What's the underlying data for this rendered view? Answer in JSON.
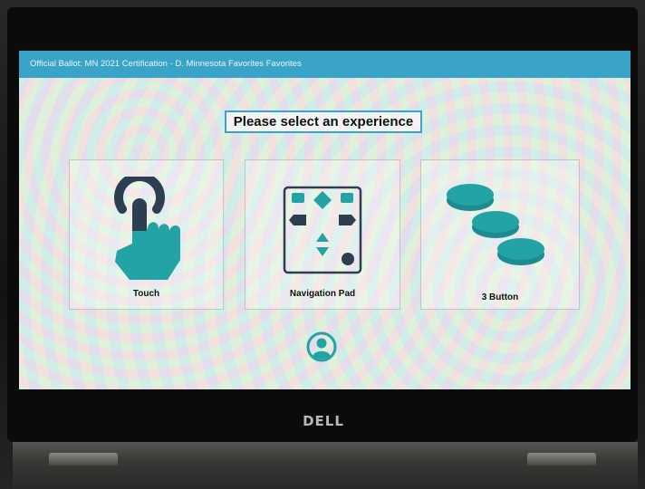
{
  "window": {
    "title": "Official Ballot: MN 2021 Certification - D. Minnesota Favorites Favorites"
  },
  "main": {
    "heading": "Please select an experience",
    "options": [
      {
        "label": "Touch",
        "icon": "touch-hand-icon"
      },
      {
        "label": "Navigation Pad",
        "icon": "navigation-pad-icon"
      },
      {
        "label": "3 Button",
        "icon": "three-button-icon"
      }
    ],
    "accessibility_icon": "person-icon"
  },
  "device": {
    "brand": "DELL"
  },
  "colors": {
    "accent": "#3aa3c8",
    "icon_teal": "#23a3a6",
    "icon_dark": "#2c3e50"
  }
}
